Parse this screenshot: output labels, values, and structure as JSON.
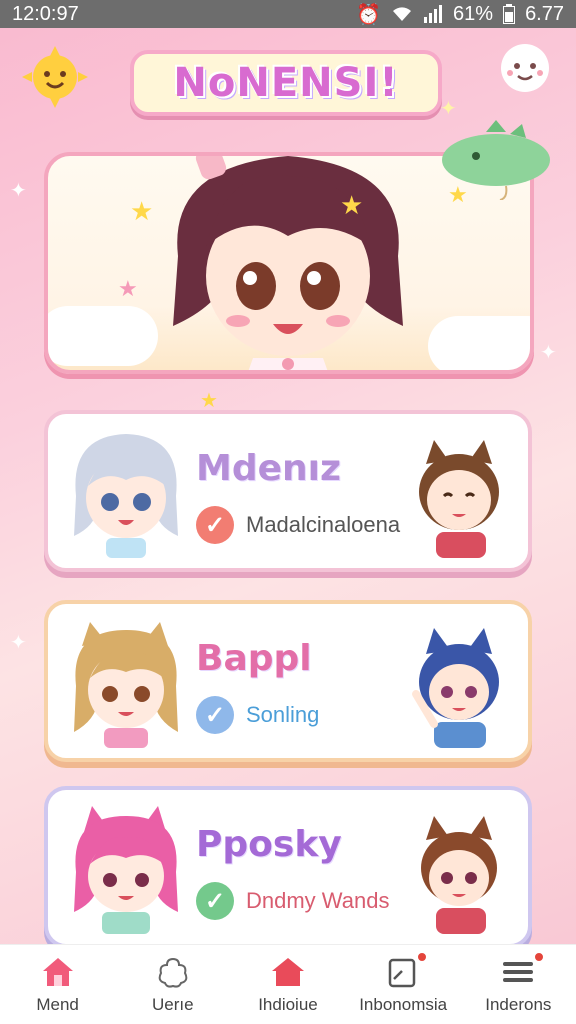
{
  "status_bar": {
    "time": "12:0:97",
    "battery_percent": "61%",
    "right_value": "6.77",
    "icons": [
      "alarm-icon",
      "wifi-icon",
      "signal-icon",
      "battery-icon"
    ]
  },
  "app": {
    "title": "NoNENSI!"
  },
  "cards": [
    {
      "title": "Mdenız",
      "status": "Madalcinaloena",
      "check_color": "#f27d72"
    },
    {
      "title": "Bappl",
      "status": "Sonling",
      "check_color": "#8fb8ea"
    },
    {
      "title": "Pposky",
      "status": "Dndmy Wands",
      "check_color": "#74c98c"
    }
  ],
  "bottom_nav": {
    "items": [
      {
        "label": "Mend",
        "icon": "home-icon",
        "active": true
      },
      {
        "label": "Uerıe",
        "icon": "flower-icon",
        "active": false
      },
      {
        "label": "Ihdioiue",
        "icon": "house-icon",
        "active": false
      },
      {
        "label": "Inbonomsia",
        "icon": "notification-icon",
        "badge": true
      },
      {
        "label": "Inderons",
        "icon": "menu-icon",
        "badge": true
      }
    ]
  },
  "colors": {
    "background": "#f9b9cf",
    "accent_pink": "#f4a6be",
    "nav_icon": "#e94b5a"
  }
}
